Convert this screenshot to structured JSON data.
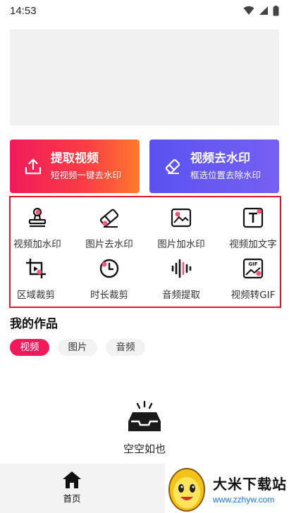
{
  "status_bar": {
    "time": "14:53"
  },
  "feature_cards": [
    {
      "title": "提取视频",
      "subtitle": "短视频一键去水印",
      "icon": "upload-icon"
    },
    {
      "title": "视频去水印",
      "subtitle": "框选位置去除水印",
      "icon": "eraser-icon"
    }
  ],
  "tools": [
    {
      "label": "视频加水印",
      "icon": "stamp-icon"
    },
    {
      "label": "图片去水印",
      "icon": "eraser-icon"
    },
    {
      "label": "图片加水印",
      "icon": "image-icon"
    },
    {
      "label": "视频加文字",
      "icon": "text-icon"
    },
    {
      "label": "区域裁剪",
      "icon": "crop-icon"
    },
    {
      "label": "时长裁剪",
      "icon": "clock-icon"
    },
    {
      "label": "音频提取",
      "icon": "waveform-icon"
    },
    {
      "label": "视频转GIF",
      "icon": "gif-icon"
    }
  ],
  "my_works": {
    "title": "我的作品",
    "tabs": [
      "视频",
      "图片",
      "音频"
    ],
    "active_tab": "视频",
    "empty_text": "空空如也"
  },
  "bottom_nav": {
    "home_label": "首页"
  },
  "watermark": {
    "site_name": "大米下载站",
    "url": "www.zzhyw.com"
  },
  "colors": {
    "accent_red": "#f21a5b",
    "accent_purple": "#5a52ee",
    "highlight_border": "#e3132a"
  }
}
